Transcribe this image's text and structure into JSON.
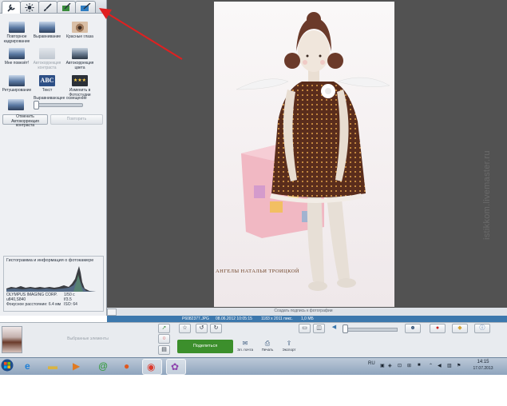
{
  "colors": {
    "preview_bg": "#525252",
    "panel_bg": "#eef0f3",
    "info_bar": "#3c78ad",
    "share_button": "#3c8f2c",
    "annotation_arrow": "#e02020",
    "taskbar": "#9fb1c6"
  },
  "tabs": [
    {
      "icon": "wrench-icon",
      "active": true
    },
    {
      "icon": "sun-icon",
      "active": false
    },
    {
      "icon": "brush-icon",
      "active": false
    },
    {
      "icon": "edit-photo-icon",
      "active": false
    },
    {
      "icon": "effects-icon",
      "active": false
    }
  ],
  "tools": [
    {
      "label": "Повторное кадрирование",
      "thumb": "blue",
      "disabled": false
    },
    {
      "label": "Выравнивание",
      "thumb": "blue",
      "disabled": false
    },
    {
      "label": "Красные глаза",
      "thumb": "eye",
      "disabled": false
    },
    {
      "label": "Мне повезёт!",
      "thumb": "blue",
      "disabled": false
    },
    {
      "label": "Автокоррекция контраста",
      "thumb": "gray",
      "disabled": true
    },
    {
      "label": "Автокоррекция цвета",
      "thumb": "sunset",
      "disabled": false
    },
    {
      "label": "Ретуширование",
      "thumb": "blue",
      "disabled": false
    },
    {
      "label": "Текст",
      "thumb": "text",
      "glyph": "ABC",
      "disabled": false
    },
    {
      "label": "Изменить в Фотостудии",
      "thumb": "stars",
      "glyph": "★★★",
      "disabled": false
    }
  ],
  "fill_light": {
    "label": "Выравнивающее освещение",
    "value": 0
  },
  "buttons": {
    "undo_contrast": "Отменить Автокоррекция контраста",
    "redo": "Повторить"
  },
  "histogram": {
    "title": "Гистограмма и информация о фотокамере",
    "camera": "OLYMPUS IMAGING CORP.",
    "model": "u840,S840",
    "shutter": "1/50 с",
    "aperture": "f/3.5",
    "focal_label": "Фокусное расстояние: 6.4 мм",
    "iso": "ISO: 64"
  },
  "photo": {
    "caption": "АНГЕЛЫ НАТАЛЬИ ТРОИЦКОЙ"
  },
  "caption_bar": {
    "placeholder": "Создать подпись к фотографии"
  },
  "info_bar": {
    "filename": "P6082377.JPG",
    "datetime": "08.06.2012 10:05:15",
    "dimensions": "1183 x 2011 пикс.",
    "size": "1,0 МБ"
  },
  "tray": {
    "label": "Выбранные элементы",
    "share": "Поделиться",
    "actions": [
      {
        "label": "Эл. почта",
        "icon": "mail-icon",
        "glyph": "✉"
      },
      {
        "label": "Печать",
        "icon": "printer-icon",
        "glyph": "⎙"
      },
      {
        "label": "Экспорт",
        "icon": "export-icon",
        "glyph": "⇪"
      }
    ]
  },
  "taskbar": {
    "language": "RU",
    "time": "14:15",
    "date": "17.07.2013"
  },
  "watermark": "istikkom.livemaster.ru"
}
